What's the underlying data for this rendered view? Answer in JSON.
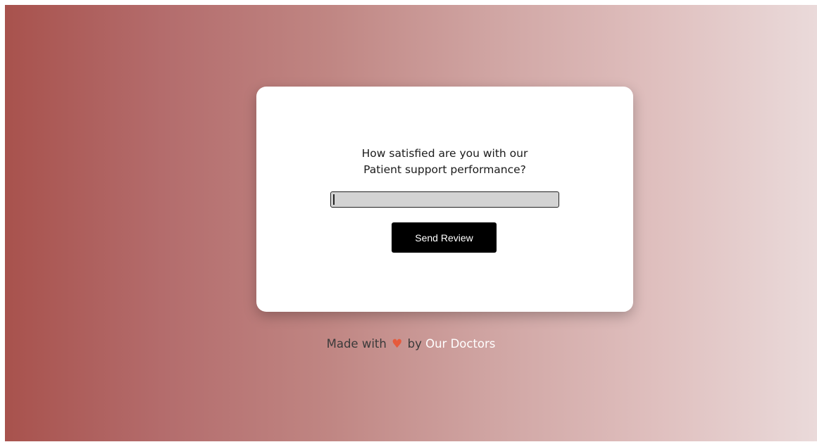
{
  "survey": {
    "question_line1": "How satisfied are you with our",
    "question_line2": "Patient support performance?",
    "input_value": "",
    "submit_label": "Send Review"
  },
  "footer": {
    "prefix": "Made with",
    "heart_icon": "heart-icon",
    "middle": "by",
    "link_text": "Our Doctors"
  },
  "colors": {
    "gradient_start": "#a8524d",
    "gradient_end": "#eadada",
    "button_bg": "#000000",
    "heart": "#e65a3c",
    "link": "#ffffff"
  }
}
